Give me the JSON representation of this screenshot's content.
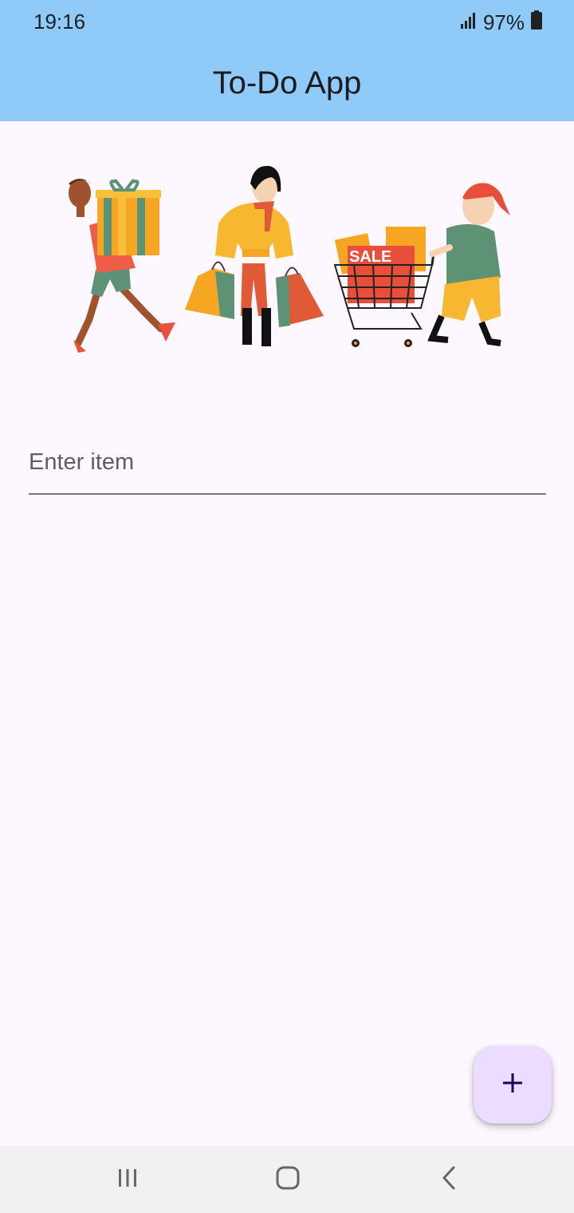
{
  "status_bar": {
    "time": "19:16",
    "battery_percent": "97%",
    "icons": [
      "signal-icon",
      "battery-icon"
    ]
  },
  "app_bar": {
    "title": "To-Do App",
    "background_color": "#90caf9"
  },
  "hero_image": {
    "icon": "shopping-people-illustration",
    "sign_text": "SALE"
  },
  "item_input": {
    "placeholder": "Enter item",
    "value": ""
  },
  "fab": {
    "icon": "add-icon",
    "background_color": "#eaddff"
  },
  "nav_bar": {
    "buttons": [
      "recent-apps-icon",
      "home-icon",
      "back-icon"
    ]
  }
}
